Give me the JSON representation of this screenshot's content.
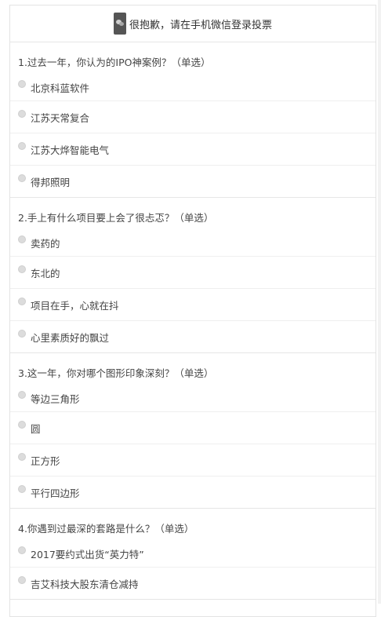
{
  "banner": {
    "text": "很抱歉，请在手机微信登录投票"
  },
  "questions": [
    {
      "title": "1.过去一年，你认为的IPO神案例？（单选）",
      "options": [
        "北京科蓝软件",
        "江苏天常复合",
        "江苏大烨智能电气",
        "得邦照明"
      ]
    },
    {
      "title": "2.手上有什么项目要上会了很忐忑？（单选）",
      "options": [
        "卖药的",
        "东北的",
        "项目在手，心就在抖",
        "心里素质好的飘过"
      ]
    },
    {
      "title": "3.这一年，你对哪个图形印象深刻？（单选）",
      "options": [
        "等边三角形",
        "圆",
        "正方形",
        "平行四边形"
      ]
    },
    {
      "title": "4.你遇到过最深的套路是什么？（单选）",
      "options": [
        "2017要约式出货“英力特”",
        "吉艾科技大股东清仓减持"
      ]
    }
  ]
}
